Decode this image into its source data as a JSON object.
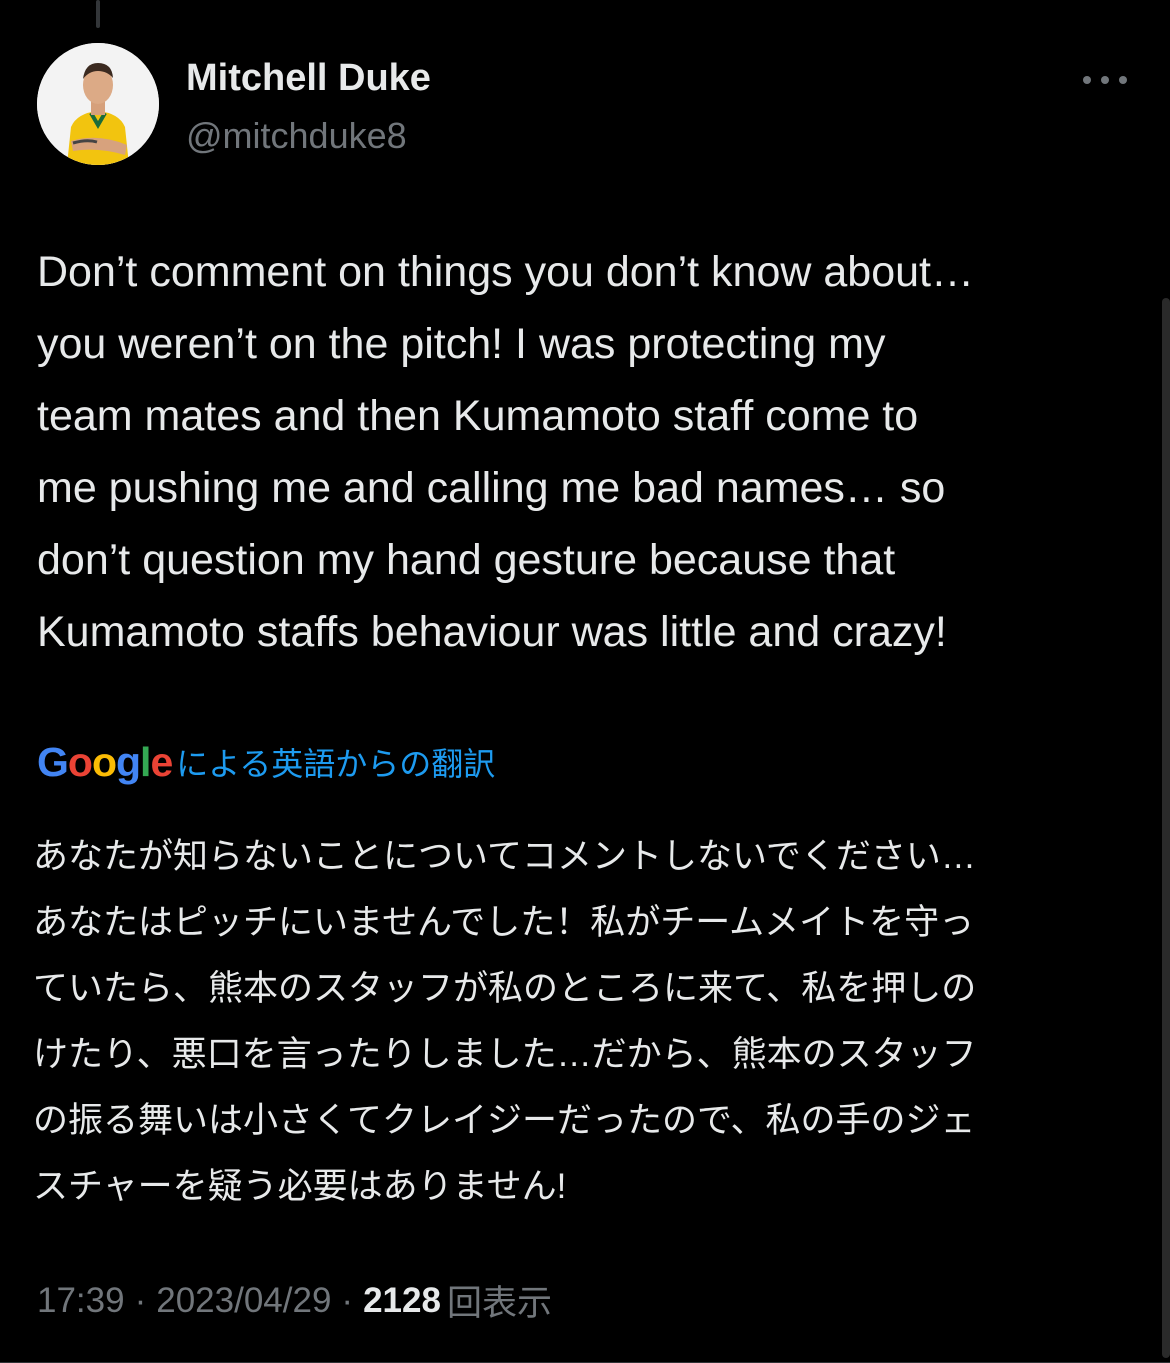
{
  "author": {
    "name": "Mitchell Duke",
    "handle": "@mitchduke8"
  },
  "tweet": {
    "text": "Don’t comment on things you don’t know about…\nyou weren’t on the pitch! I was protecting my\nteam mates and then Kumamoto staff come to\nme pushing me and calling me bad names… so\ndon’t question my hand gesture because that\nKumamoto staffs behaviour was little and crazy!",
    "translation_label": "による英語からの翻訳",
    "translated_text": "あなたが知らないことについてコメントしないでください…\nあなたはピッチにいませんでした！私がチームメイトを守っ\nていたら、熊本のスタッフが私のところに来て、私を押しの\nけたり、悪口を言ったりしました…だから、熊本のスタッフ\nの振る舞いは小さくてクレイジーだったので、私の手のジェ\nスチャーを疑う必要はありません!",
    "time": "17:39",
    "date": "2023/04/29",
    "views": "2128",
    "views_label": "回表示",
    "separator": "·"
  },
  "google_logo": {
    "letters": [
      "G",
      "o",
      "o",
      "g",
      "l",
      "e"
    ],
    "colors": [
      "#4285F4",
      "#EA4335",
      "#FBBC05",
      "#4285F4",
      "#34A853",
      "#EA4335"
    ]
  },
  "colors": {
    "background": "#000000",
    "text": "#e7e9ea",
    "secondary": "#71767b",
    "link": "#1d9bf0"
  }
}
